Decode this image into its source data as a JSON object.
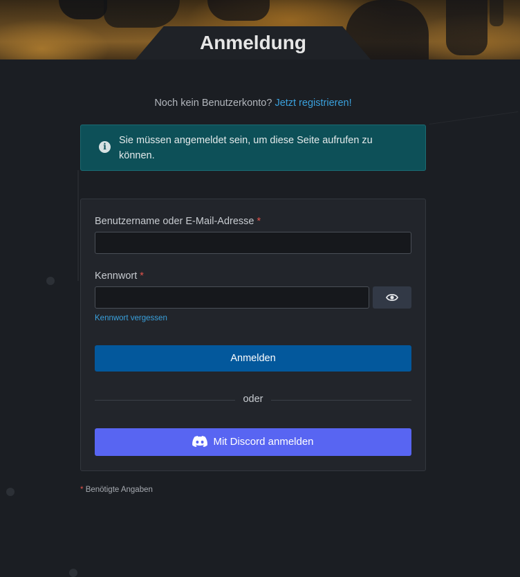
{
  "header": {
    "title": "Anmeldung"
  },
  "register": {
    "prompt": "Noch kein Benutzerkonto?",
    "link": "Jetzt registrieren!"
  },
  "alert": {
    "icon": "info-icon",
    "text": "Sie müssen angemeldet sein, um diese Seite aufrufen zu können."
  },
  "form": {
    "username_label": "Benutzername oder E-Mail-Adresse",
    "username_value": "",
    "password_label": "Kennwort",
    "password_value": "",
    "required_marker": "*",
    "show_password_icon": "eye-icon",
    "forgot_password": "Kennwort vergessen",
    "submit_label": "Anmelden",
    "divider_text": "oder",
    "discord_label": "Mit Discord anmelden",
    "discord_icon": "discord-icon"
  },
  "footer": {
    "required_marker": "*",
    "required_note": "Benötigte Angaben"
  },
  "colors": {
    "background": "#1b1e23",
    "card": "#22252b",
    "alert": "#0d5058",
    "primary": "#03589c",
    "discord": "#5865f2",
    "link": "#3aa1dd",
    "required": "#e0524a"
  }
}
